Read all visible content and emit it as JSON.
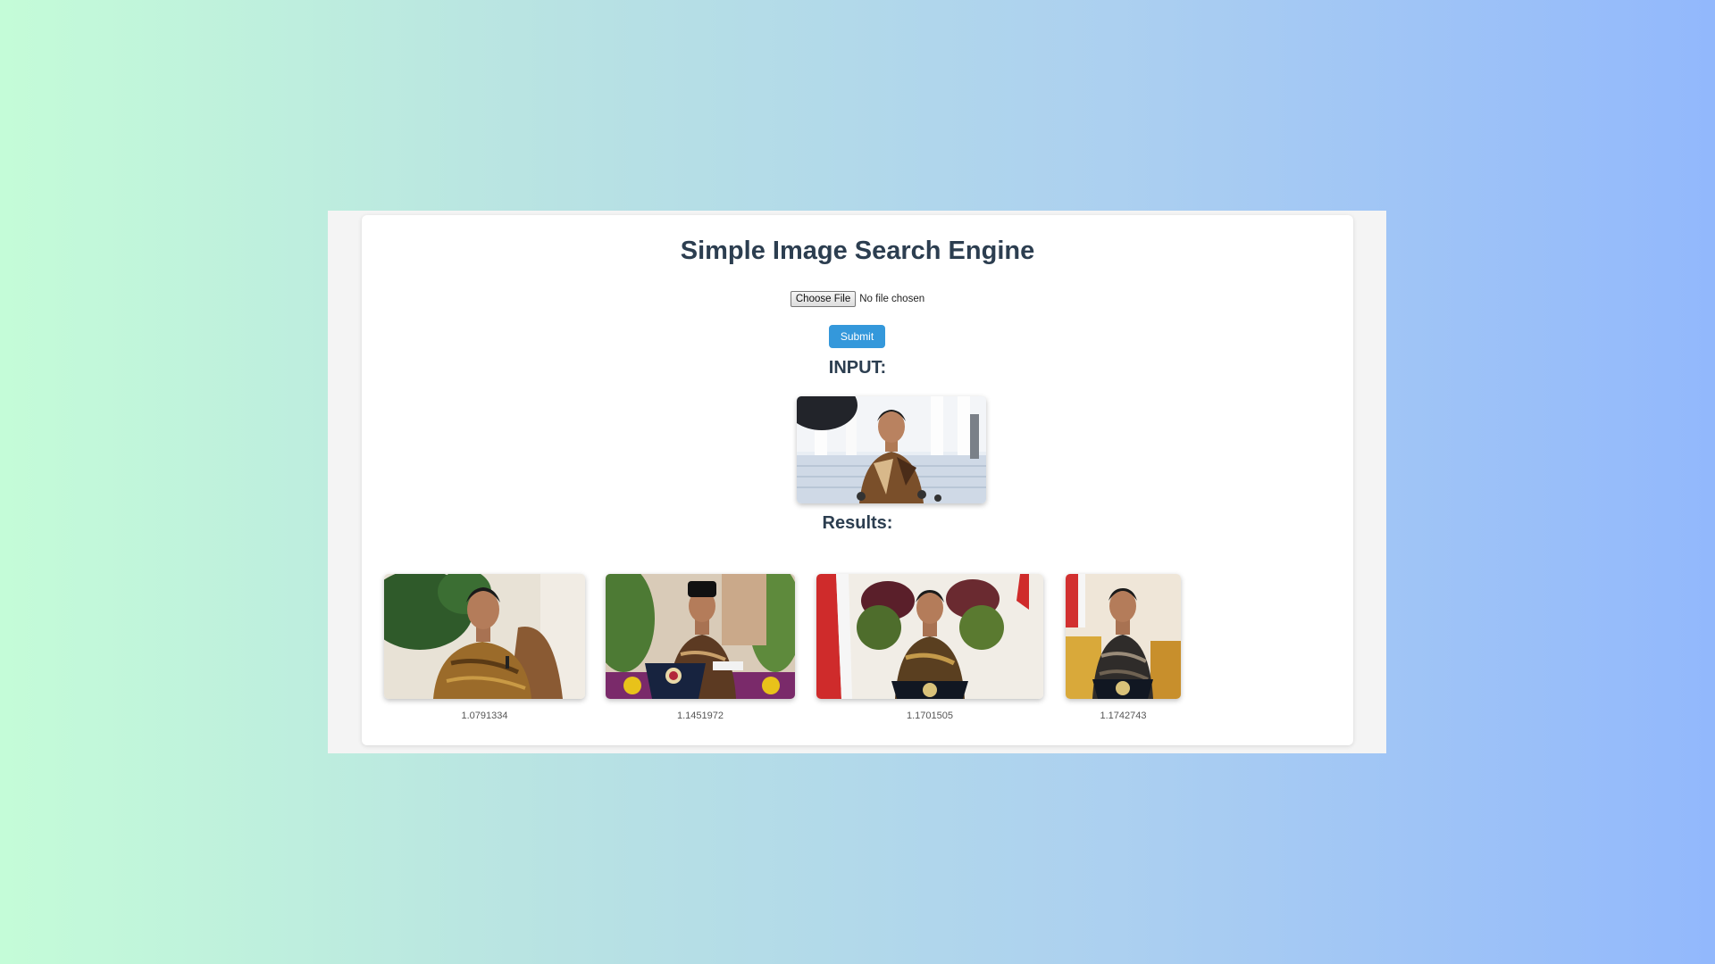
{
  "page": {
    "title": "Simple Image Search Engine"
  },
  "upload": {
    "button_label": "Choose File",
    "status_text": "No file chosen"
  },
  "submit": {
    "label": "Submit"
  },
  "input_section": {
    "heading": "INPUT:"
  },
  "results_section": {
    "heading": "Results:",
    "items": [
      {
        "score": "1.0791334"
      },
      {
        "score": "1.1451972"
      },
      {
        "score": "1.1701505"
      },
      {
        "score": "1.1742743"
      }
    ]
  },
  "colors": {
    "accent": "#3498db",
    "heading": "#2c3e50",
    "score_text": "#555555"
  }
}
